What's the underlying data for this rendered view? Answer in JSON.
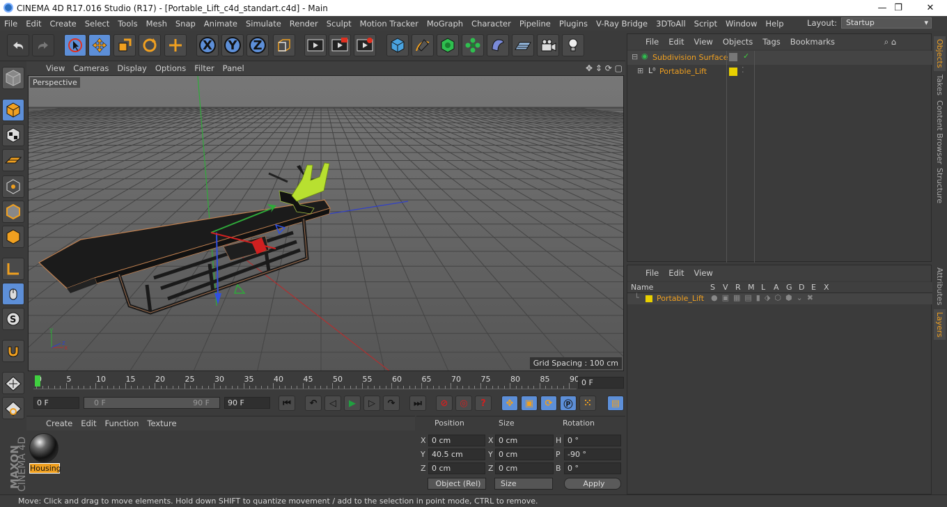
{
  "window": {
    "title": "CINEMA 4D R17.016 Studio (R17) - [Portable_Lift_c4d_standart.c4d] - Main",
    "minimize": "—",
    "maximize": "❐",
    "close": "✕"
  },
  "menu": [
    "File",
    "Edit",
    "Create",
    "Select",
    "Tools",
    "Mesh",
    "Snap",
    "Animate",
    "Simulate",
    "Render",
    "Sculpt",
    "Motion Tracker",
    "MoGraph",
    "Character",
    "Pipeline",
    "Plugins",
    "V-Ray Bridge",
    "3DToAll",
    "Script",
    "Window",
    "Help"
  ],
  "layout": {
    "label": "Layout:",
    "value": "Startup"
  },
  "toolbar": {
    "axis_x": "X",
    "axis_y": "Y",
    "axis_z": "Z"
  },
  "viewport": {
    "menu": [
      "View",
      "Cameras",
      "Display",
      "Options",
      "Filter",
      "Panel"
    ],
    "camera_label": "Perspective",
    "grid_spacing": "Grid Spacing : 100 cm"
  },
  "timeline": {
    "ticks": [
      "0",
      "5",
      "10",
      "15",
      "20",
      "25",
      "30",
      "35",
      "40",
      "45",
      "50",
      "55",
      "60",
      "65",
      "70",
      "75",
      "80",
      "85",
      "90"
    ],
    "current_frame": "0 F"
  },
  "transport": {
    "start": "0 F",
    "range_start": "0 F",
    "range_end": "90 F",
    "end": "90 F"
  },
  "material": {
    "menu": [
      "Create",
      "Edit",
      "Function",
      "Texture"
    ],
    "name": "Housing"
  },
  "coords": {
    "headers": {
      "position": "Position",
      "size": "Size",
      "rotation": "Rotation"
    },
    "rows": [
      {
        "pl": "X",
        "pv": "0 cm",
        "sl": "X",
        "sv": "0 cm",
        "rl": "H",
        "rv": "0 °"
      },
      {
        "pl": "Y",
        "pv": "40.5 cm",
        "sl": "Y",
        "sv": "0 cm",
        "rl": "P",
        "rv": "-90 °"
      },
      {
        "pl": "Z",
        "pv": "0 cm",
        "sl": "Z",
        "sv": "0 cm",
        "rl": "B",
        "rv": "0 °"
      }
    ],
    "mode": "Object (Rel)",
    "size_mode": "Size",
    "apply": "Apply"
  },
  "objects": {
    "menu": [
      "File",
      "Edit",
      "View",
      "Objects",
      "Tags",
      "Bookmarks"
    ],
    "items": [
      "Subdivision Surface",
      "Portable_Lift"
    ]
  },
  "layers": {
    "menu": [
      "File",
      "Edit",
      "View"
    ],
    "columns": [
      "Name",
      "S",
      "V",
      "R",
      "M",
      "L",
      "A",
      "G",
      "D",
      "E",
      "X"
    ],
    "item": "Portable_Lift"
  },
  "sidetabs": [
    "Objects",
    "Takes",
    "Content Browser",
    "Structure",
    "Attributes",
    "Layers"
  ],
  "brand": {
    "maxon": "MAXON",
    "cinema": "CINEMA 4D"
  },
  "status": "Move: Click and drag to move elements. Hold down SHIFT to quantize movement / add to the selection in point mode, CTRL to remove.",
  "colors": {
    "accent": "#f0a020",
    "layer_yellow": "#e8d000",
    "active_blue": "#5d8fd8"
  }
}
